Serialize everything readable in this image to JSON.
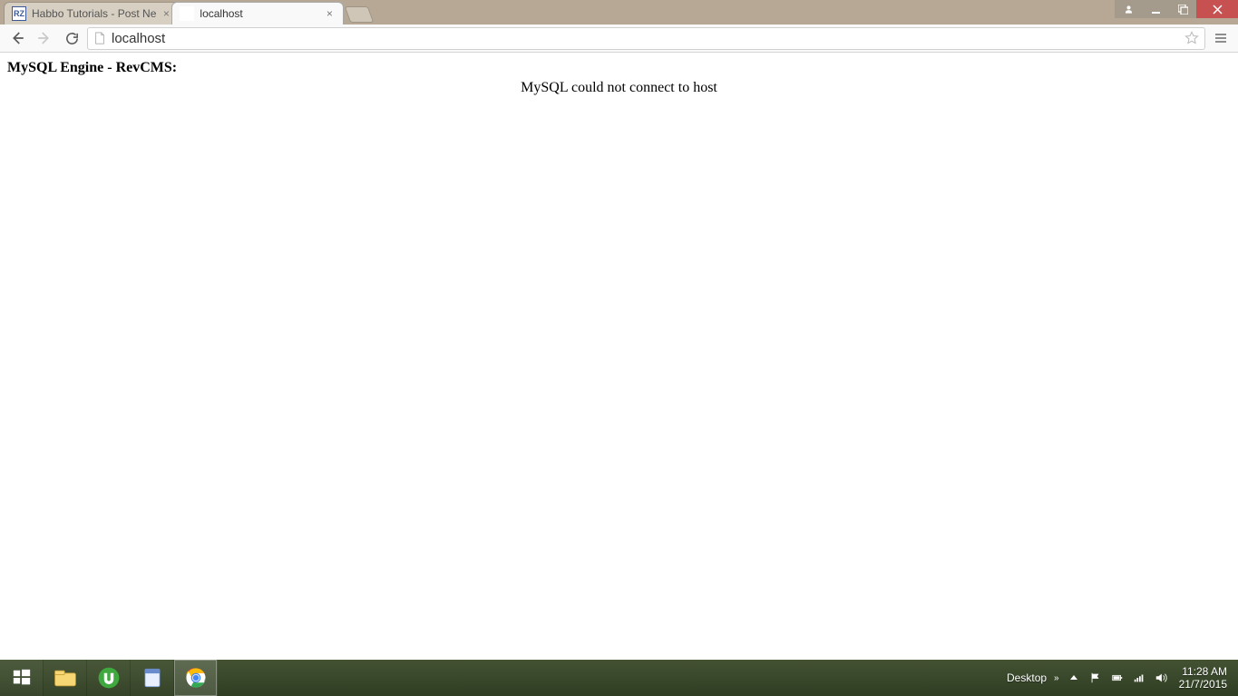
{
  "tabs": [
    {
      "title": "Habbo Tutorials - Post Ne",
      "favicon": "RZ",
      "active": false
    },
    {
      "title": "localhost",
      "favicon": "page",
      "active": true
    }
  ],
  "omnibox": {
    "value": "localhost"
  },
  "page": {
    "heading": "MySQL Engine - RevCMS:",
    "message": "MySQL could not connect to host"
  },
  "tray": {
    "desktop_label": "Desktop",
    "time": "11:28 AM",
    "date": "21/7/2015"
  }
}
